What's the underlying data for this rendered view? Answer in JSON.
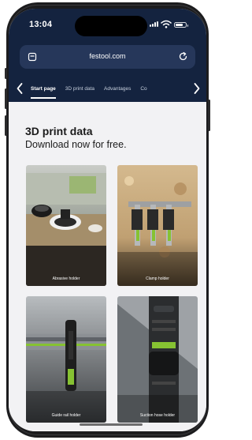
{
  "status_bar": {
    "time": "13:04",
    "battery_level": 0.75
  },
  "browser": {
    "url": "festool.com",
    "left_icon": "tabs-icon",
    "right_icon": "reload-icon"
  },
  "nav": {
    "tabs": [
      {
        "label": "Start page",
        "active": true
      },
      {
        "label": "3D print data",
        "active": false
      },
      {
        "label": "Advantages",
        "active": false
      },
      {
        "label": "Co",
        "active": false
      }
    ]
  },
  "page": {
    "title": "3D print data",
    "subtitle": "Download now for free."
  },
  "cards": [
    {
      "label": "Abrasive holder"
    },
    {
      "label": "Clamp holder"
    },
    {
      "label": "Guide rail holder"
    },
    {
      "label": "Suction hose holder"
    }
  ],
  "colors": {
    "header_bg": "#14233f",
    "urlbar_bg": "#26375a",
    "accent_green": "#86c232",
    "content_bg": "#f2f2f4"
  }
}
